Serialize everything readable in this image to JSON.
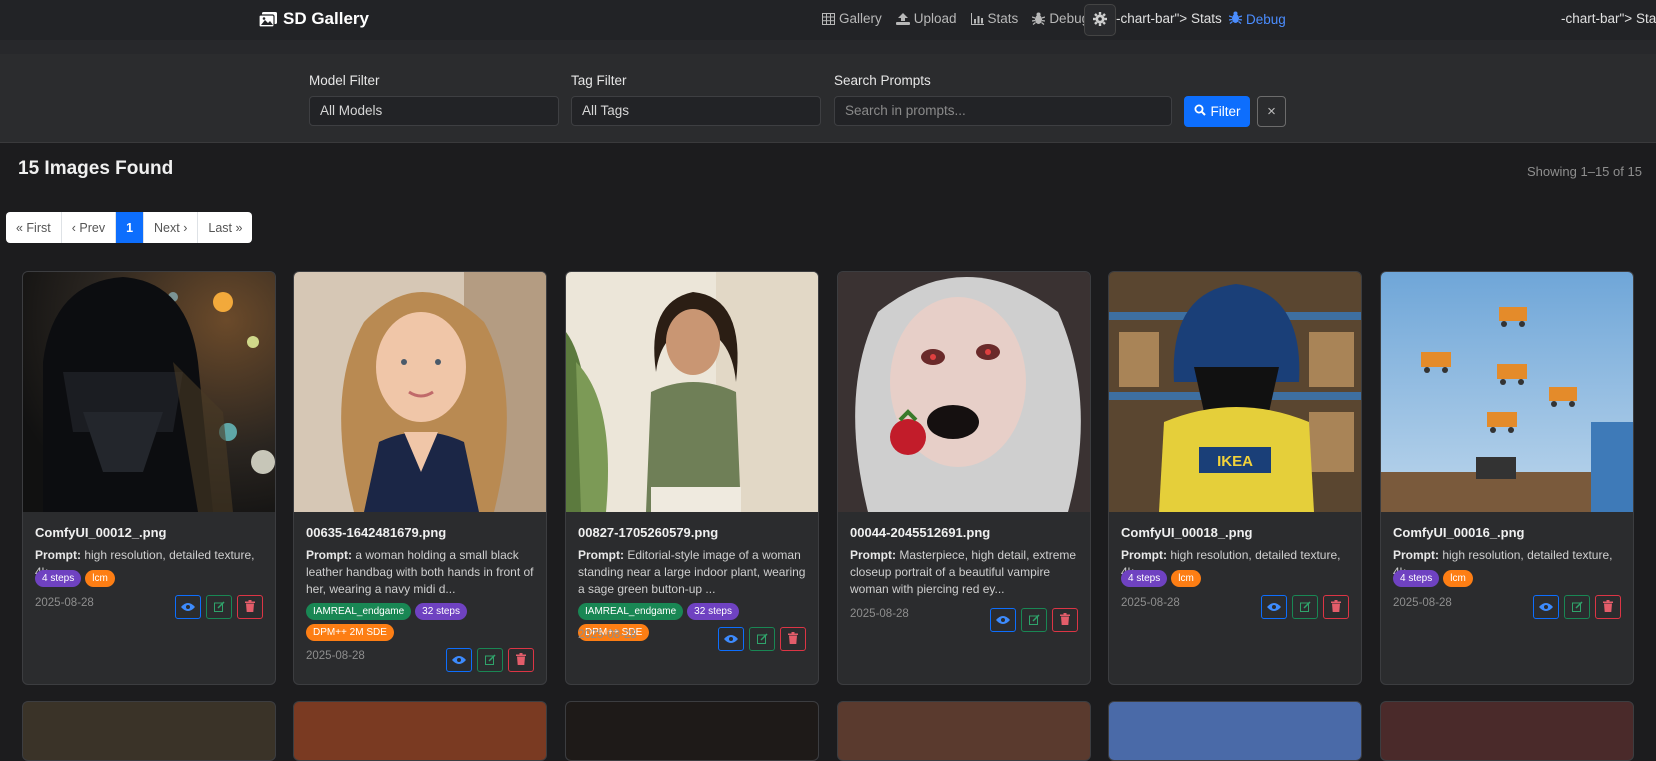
{
  "navbar": {
    "brand": "SD Gallery",
    "links": [
      {
        "label": "Gallery",
        "icon": "table-icon"
      },
      {
        "label": "Upload",
        "icon": "upload-icon"
      },
      {
        "label": "Stats",
        "icon": "chart-icon"
      },
      {
        "label": "Debug",
        "icon": "bug-icon"
      }
    ],
    "broken_text_1": "-chart-bar\"> Stats",
    "debug_active_label": "Debug",
    "broken_text_2": "-chart-bar\"> Stats"
  },
  "filters": {
    "model_label": "Model Filter",
    "model_value": "All Models",
    "tag_label": "Tag Filter",
    "tag_value": "All Tags",
    "search_label": "Search Prompts",
    "search_placeholder": "Search in prompts...",
    "filter_button": "Filter",
    "clear_button": "×"
  },
  "results": {
    "title": "15 Images Found",
    "showing": "Showing 1–15 of 15"
  },
  "pagination": [
    "« First",
    "‹ Prev",
    "1",
    "Next ›",
    "Last »"
  ],
  "cards": [
    {
      "title": "ComfyUI_00012_.png",
      "prompt_label": "Prompt:",
      "prompt": "high resolution, detailed texture, 4k,",
      "tags": [
        {
          "text": "4 steps",
          "color": "purple"
        },
        {
          "text": "lcm",
          "color": "orange"
        }
      ],
      "date": "2025-08-28"
    },
    {
      "title": "00635-1642481679.png",
      "prompt_label": "Prompt:",
      "prompt": "a woman holding a small black leather handbag with both hands in front of her, wearing a navy midi d...",
      "tags": [
        {
          "text": "IAMREAL_endgame",
          "color": "green"
        },
        {
          "text": "32 steps",
          "color": "purple"
        },
        {
          "text": "DPM++ 2M SDE",
          "color": "orange"
        }
      ],
      "date": "2025-08-28"
    },
    {
      "title": "00827-1705260579.png",
      "prompt_label": "Prompt:",
      "prompt": "Editorial-style image of a woman standing near a large indoor plant, wearing a sage green button-up ...",
      "tags": [
        {
          "text": "IAMREAL_endgame",
          "color": "green"
        },
        {
          "text": "32 steps",
          "color": "purple"
        },
        {
          "text": "DPM++ SDE",
          "color": "orange"
        }
      ],
      "date": "2025-08-28"
    },
    {
      "title": "00044-2045512691.png",
      "prompt_label": "Prompt:",
      "prompt": "Masterpiece, high detail, extreme closeup portrait of a beautiful vampire woman with piercing red ey...",
      "tags": [],
      "date": "2025-08-28"
    },
    {
      "title": "ComfyUI_00018_.png",
      "prompt_label": "Prompt:",
      "prompt": "high resolution, detailed texture, 4k,",
      "tags": [
        {
          "text": "4 steps",
          "color": "purple"
        },
        {
          "text": "lcm",
          "color": "orange"
        }
      ],
      "date": "2025-08-28"
    },
    {
      "title": "ComfyUI_00016_.png",
      "prompt_label": "Prompt:",
      "prompt": "high resolution, detailed texture, 4k,",
      "tags": [
        {
          "text": "4 steps",
          "color": "purple"
        },
        {
          "text": "lcm",
          "color": "orange"
        }
      ],
      "date": "2025-08-28"
    }
  ],
  "colors": {
    "accent": "#0d6efd",
    "tag_purple": "#6f42c1",
    "tag_orange": "#fd7e14",
    "tag_green": "#198754",
    "danger": "#dc3545"
  }
}
